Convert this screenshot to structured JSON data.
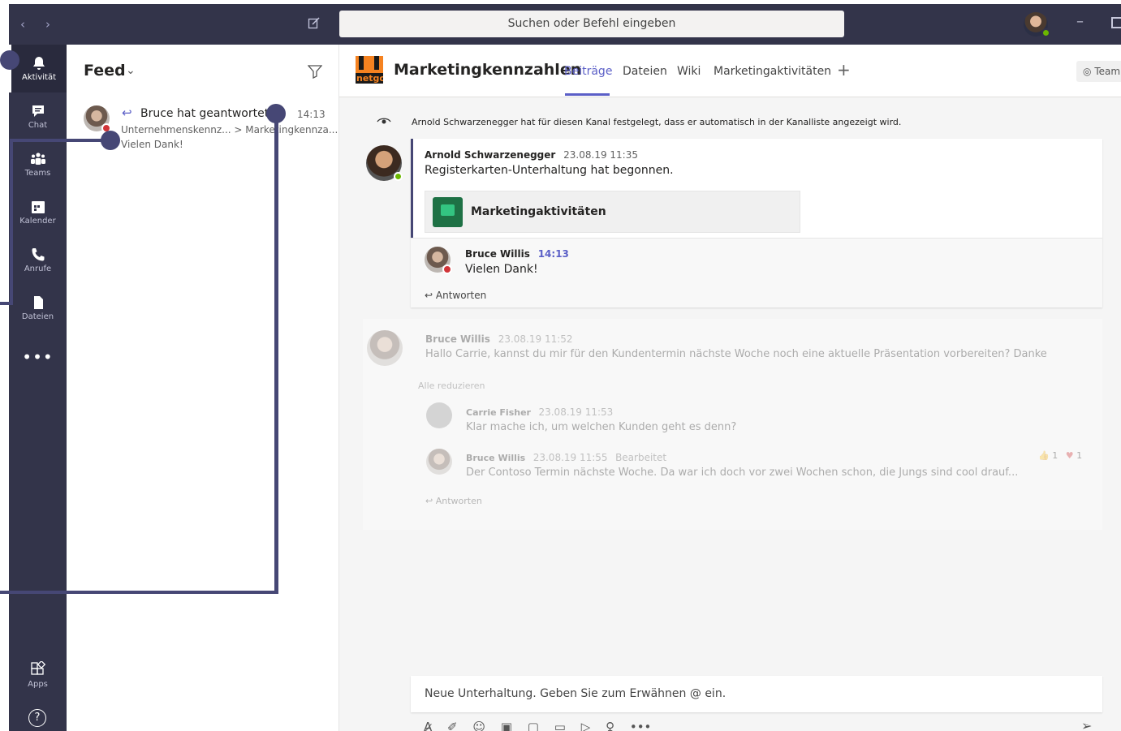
{
  "search": {
    "placeholder": "Suchen oder Befehl eingeben"
  },
  "rail": {
    "items": [
      {
        "label": "Aktivität"
      },
      {
        "label": "Chat"
      },
      {
        "label": "Teams"
      },
      {
        "label": "Kalender"
      },
      {
        "label": "Anrufe"
      },
      {
        "label": "Dateien"
      }
    ],
    "more": "•••",
    "apps": "Apps",
    "help": "Hilfe"
  },
  "feed": {
    "title": "Feed",
    "item": {
      "title": "Bruce hat geantwortet",
      "time": "14:13",
      "path": "Unternehmenskennz... > Marketingkennza...",
      "preview": "Vielen Dank!"
    }
  },
  "channel": {
    "name": "Marketingkennzahlen",
    "logo_text": "netgo",
    "tabs": [
      "Beiträge",
      "Dateien",
      "Wiki",
      "Marketingaktivitäten"
    ],
    "add_tab": "+",
    "team_button": "Team"
  },
  "system_message": {
    "author": "Arnold Schwarzenegger",
    "text": "hat für diesen Kanal festgelegt, dass er automatisch in der Kanalliste angezeigt wird."
  },
  "thread1": {
    "author": "Arnold Schwarzenegger",
    "time": "23.08.19 11:35",
    "text": "Registerkarten-Unterhaltung hat begonnen.",
    "tab_card": "Marketingaktivitäten",
    "reply": {
      "author": "Bruce Willis",
      "time": "14:13",
      "text": "Vielen Dank!"
    },
    "reply_action": "Antworten"
  },
  "thread2": {
    "author": "Bruce Willis",
    "time": "23.08.19 11:52",
    "text": "Hallo Carrie, kannst du mir für den Kundentermin nächste Woche noch eine aktuelle Präsentation vorbereiten? Danke",
    "collapse": "Alle reduzieren",
    "replies": [
      {
        "author": "Carrie Fisher",
        "time": "23.08.19 11:53",
        "edited": "",
        "text": "Klar mache ich, um welchen Kunden geht es denn?"
      },
      {
        "author": "Bruce Willis",
        "time": "23.08.19 11:55",
        "edited": "Bearbeitet",
        "text": "Der Contoso Termin nächste Woche. Da war ich doch vor zwei Wochen schon, die Jungs sind cool drauf..."
      }
    ],
    "reactions": {
      "like": "1",
      "heart": "1"
    },
    "reply_action": "Antworten"
  },
  "composer": {
    "placeholder": "Neue Unterhaltung. Geben Sie zum Erwähnen @ ein.",
    "more": "•••"
  },
  "colors": {
    "rail": "#33344a",
    "accent": "#5b5fc7",
    "highlight": "#464775"
  }
}
